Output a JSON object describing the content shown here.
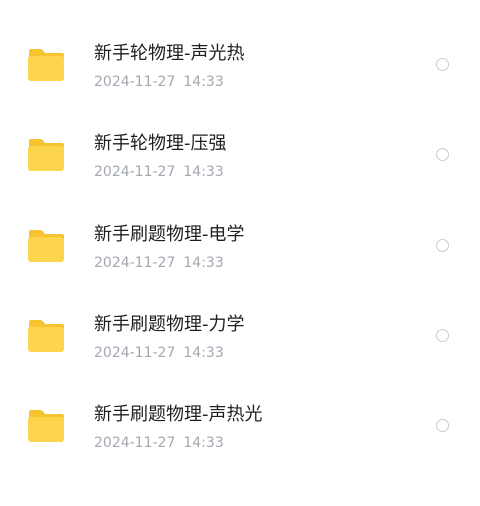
{
  "files": [
    {
      "name": "新手轮物理-声光热",
      "date": "2024-11-27",
      "time": "14:33",
      "selected": false
    },
    {
      "name": "新手轮物理-压强",
      "date": "2024-11-27",
      "time": "14:33",
      "selected": false
    },
    {
      "name": "新手刷题物理-电学",
      "date": "2024-11-27",
      "time": "14:33",
      "selected": false
    },
    {
      "name": "新手刷题物理-力学",
      "date": "2024-11-27",
      "time": "14:33",
      "selected": false
    },
    {
      "name": "新手刷题物理-声热光",
      "date": "2024-11-27",
      "time": "14:33",
      "selected": false
    }
  ],
  "colors": {
    "folder_body": "#fcd54c",
    "folder_tab": "#f6c331",
    "name_text": "#1f1f1f",
    "meta_text": "#a3a8b0",
    "radio_border": "#c8ccd2"
  },
  "icons": {
    "folder": "folder-icon",
    "select": "radio-unchecked-icon"
  }
}
